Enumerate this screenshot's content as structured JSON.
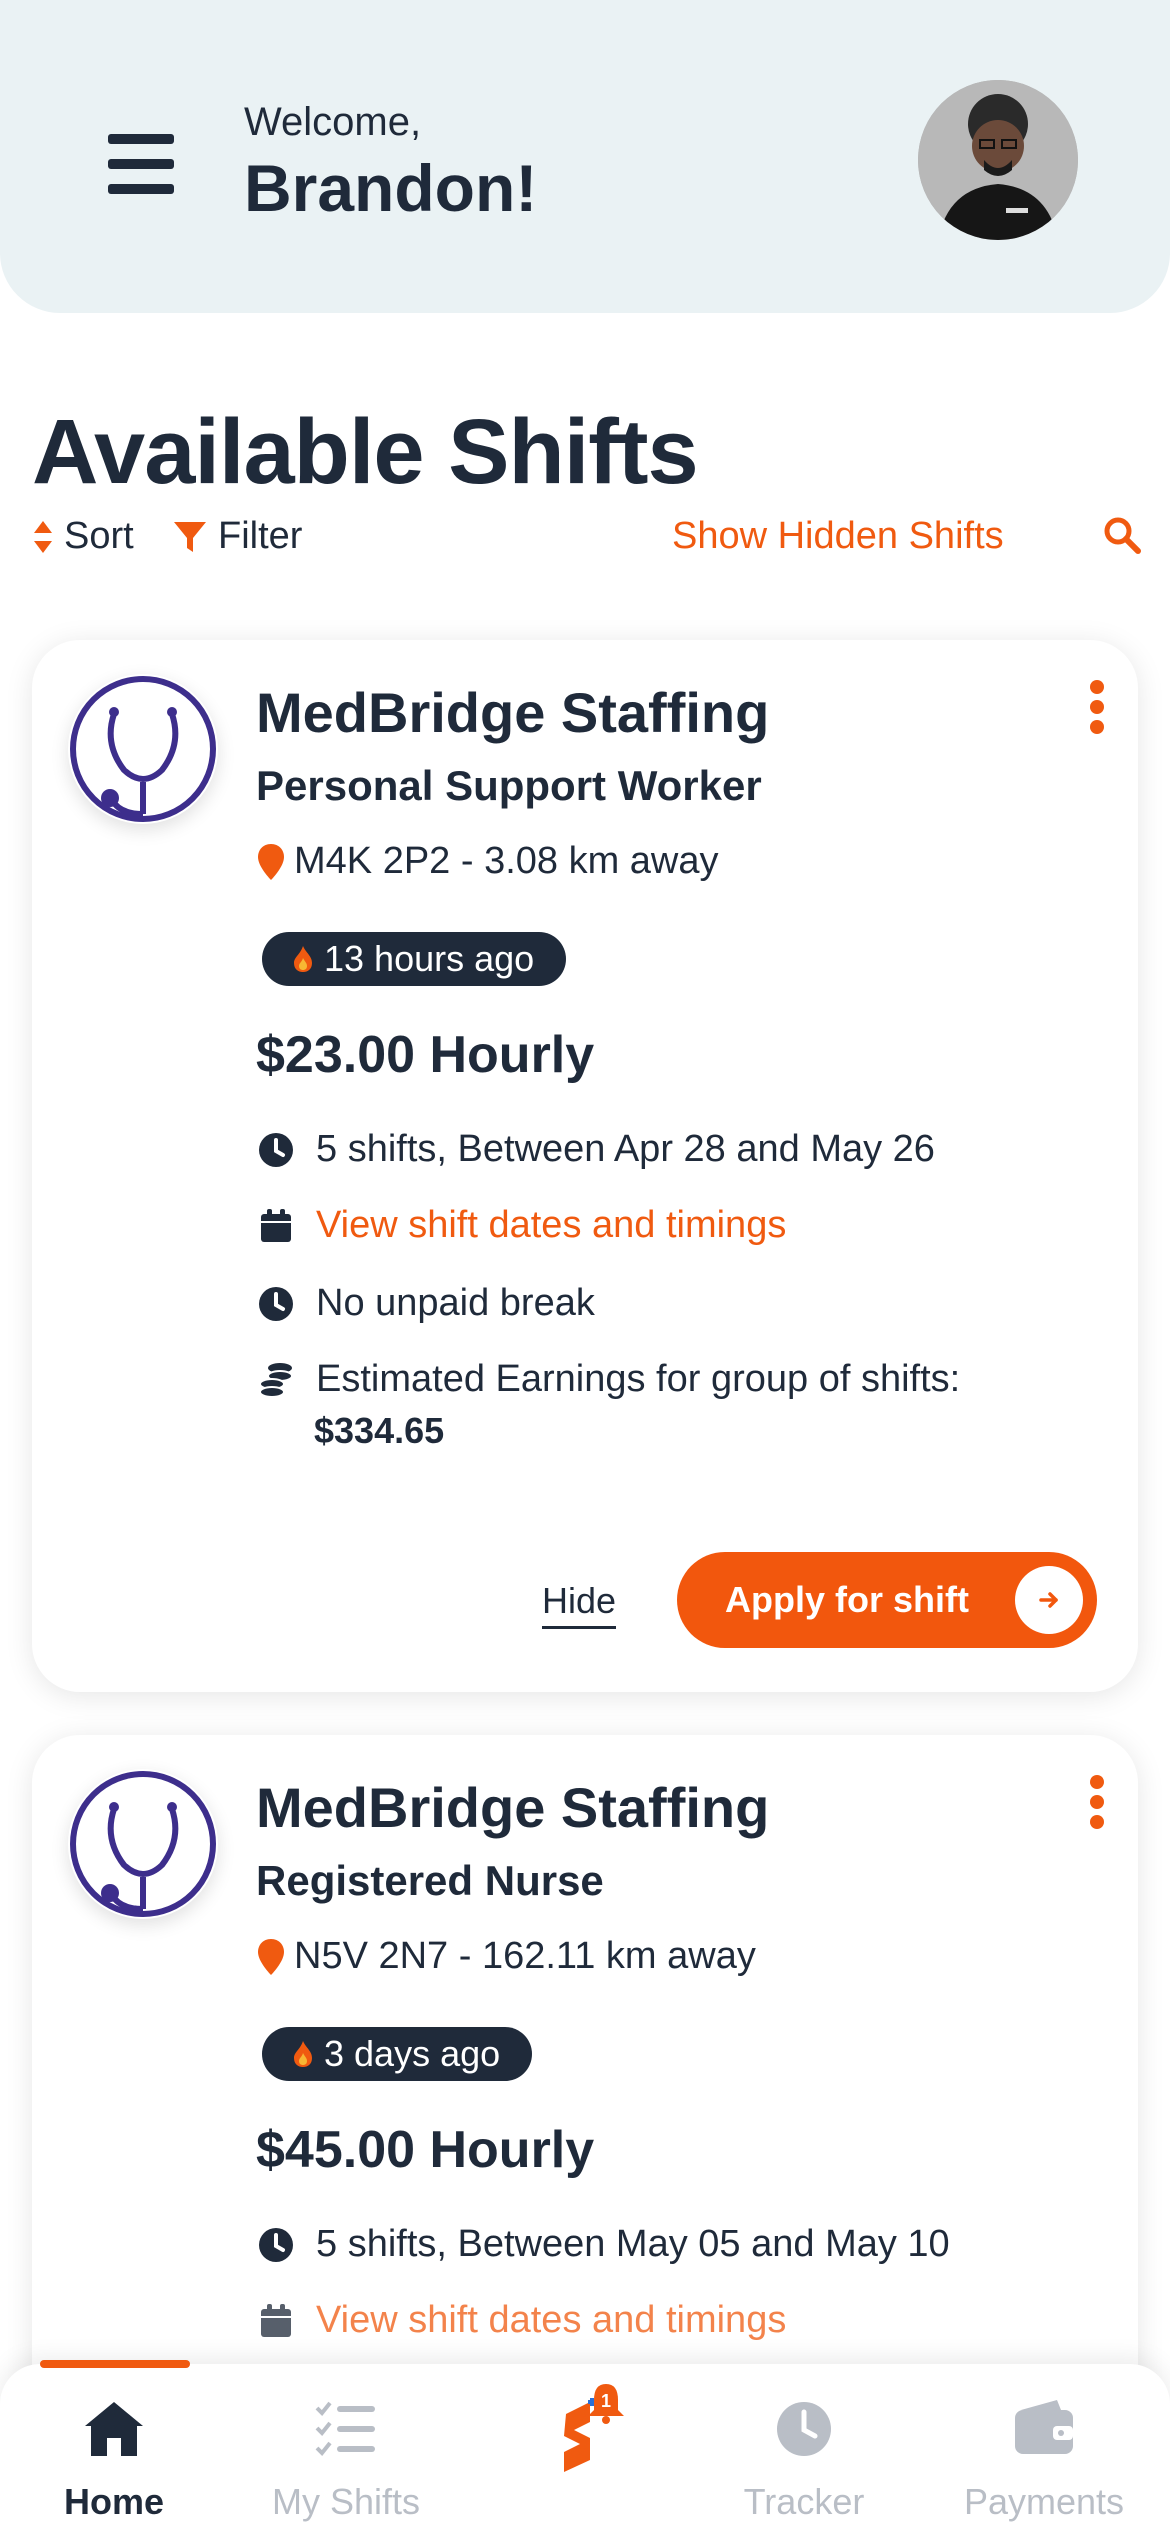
{
  "header": {
    "welcome": "Welcome,",
    "username": "Brandon!"
  },
  "page": {
    "title": "Available Shifts"
  },
  "toolbar": {
    "sort_label": "Sort",
    "filter_label": "Filter",
    "hidden_label": "Show Hidden Shifts"
  },
  "shifts": [
    {
      "company": "MedBridge Staffing",
      "role": "Personal Support Worker",
      "location": "M4K 2P2 - 3.08 km away",
      "posted": "13 hours ago",
      "rate": "$23.00 Hourly",
      "schedule": "5 shifts, Between Apr 28 and May 26",
      "dates_link": "View shift dates and timings",
      "break": "No unpaid break",
      "earnings_label": "Estimated Earnings for group of shifts:",
      "earnings_amount": "$334.65",
      "hide_label": "Hide",
      "apply_label": "Apply for shift"
    },
    {
      "company": "MedBridge Staffing",
      "role": "Registered Nurse",
      "location": "N5V 2N7 - 162.11 km away",
      "posted": "3 days ago",
      "rate": "$45.00 Hourly",
      "schedule": "5 shifts, Between May 05 and May 10",
      "dates_link": "View shift dates and timings"
    }
  ],
  "nav": {
    "home": "Home",
    "my_shifts": "My Shifts",
    "center_badge": "1",
    "tracker": "Tracker",
    "payments": "Payments"
  },
  "colors": {
    "accent": "#f05a10",
    "dark": "#1f2a3a",
    "header_bg": "#eaf2f4",
    "logo_purple": "#3d2e8c",
    "muted": "#b9bec6"
  }
}
